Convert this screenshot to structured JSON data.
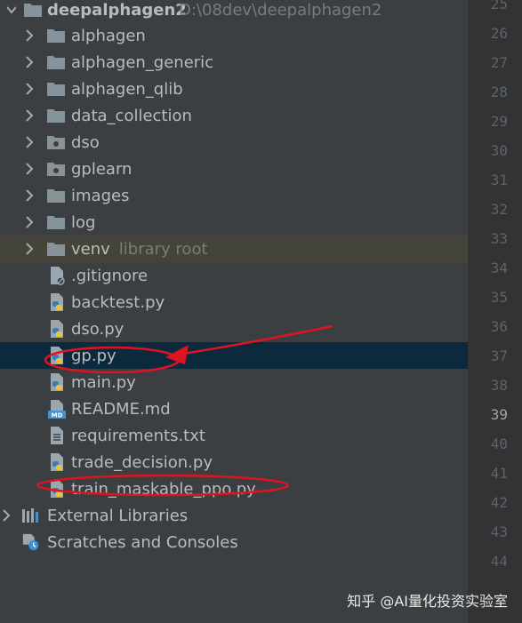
{
  "project": {
    "name": "deepalphagen2",
    "path": "D:\\08dev\\deepalphagen2"
  },
  "tree": {
    "folders": [
      "alphagen",
      "alphagen_generic",
      "alphagen_qlib",
      "data_collection",
      "dso",
      "gplearn",
      "images",
      "log",
      "venv"
    ],
    "venv_hint": "library root",
    "files": [
      ".gitignore",
      "backtest.py",
      "dso.py",
      "gp.py",
      "main.py",
      "README.md",
      "requirements.txt",
      "trade_decision.py",
      "train_maskable_ppo.py"
    ],
    "external_libraries": "External Libraries",
    "scratches": "Scratches and Consoles"
  },
  "gutter": {
    "line_numbers": [
      "25",
      "26",
      "27",
      "28",
      "29",
      "30",
      "31",
      "32",
      "33",
      "34",
      "35",
      "36",
      "37",
      "38",
      "39",
      "40",
      "41",
      "42",
      "43",
      "44"
    ],
    "current_line": "39"
  },
  "watermark": "知乎 @AI量化投资实验室",
  "colors": {
    "panel_bg": "#3c3f41",
    "gutter_bg": "#313335",
    "selected_row": "#0d293e",
    "venv_row": "#45443b",
    "annotation_red": "#e0141e"
  }
}
